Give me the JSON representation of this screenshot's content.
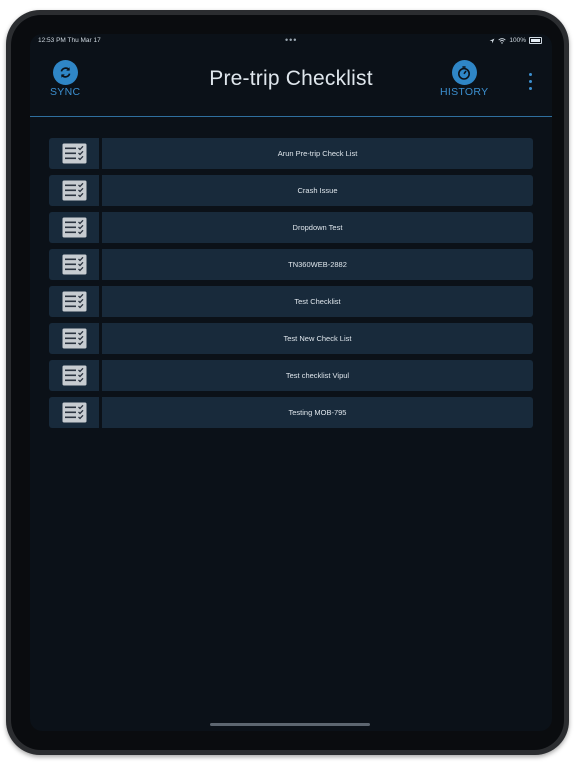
{
  "status_bar": {
    "time": "12:53 PM  Thu Mar 17",
    "dots": "•••",
    "battery": "100%"
  },
  "header": {
    "title": "Pre-trip Checklist",
    "sync_label": "SYNC",
    "history_label": "HISTORY"
  },
  "checklists": [
    {
      "label": "Arun Pre-trip Check List"
    },
    {
      "label": "Crash Issue"
    },
    {
      "label": "Dropdown Test"
    },
    {
      "label": "TN360WEB-2882"
    },
    {
      "label": "Test Checklist"
    },
    {
      "label": "Test New Check List"
    },
    {
      "label": "Test checklist Vipul"
    },
    {
      "label": "Testing MOB-795"
    }
  ],
  "colors": {
    "background": "#0b1118",
    "row": "#182a3b",
    "accent": "#2f86c6"
  },
  "icons": {
    "sync": "refresh-icon",
    "history": "timer-icon",
    "row": "checklist-icon",
    "menu": "kebab-menu-icon"
  }
}
